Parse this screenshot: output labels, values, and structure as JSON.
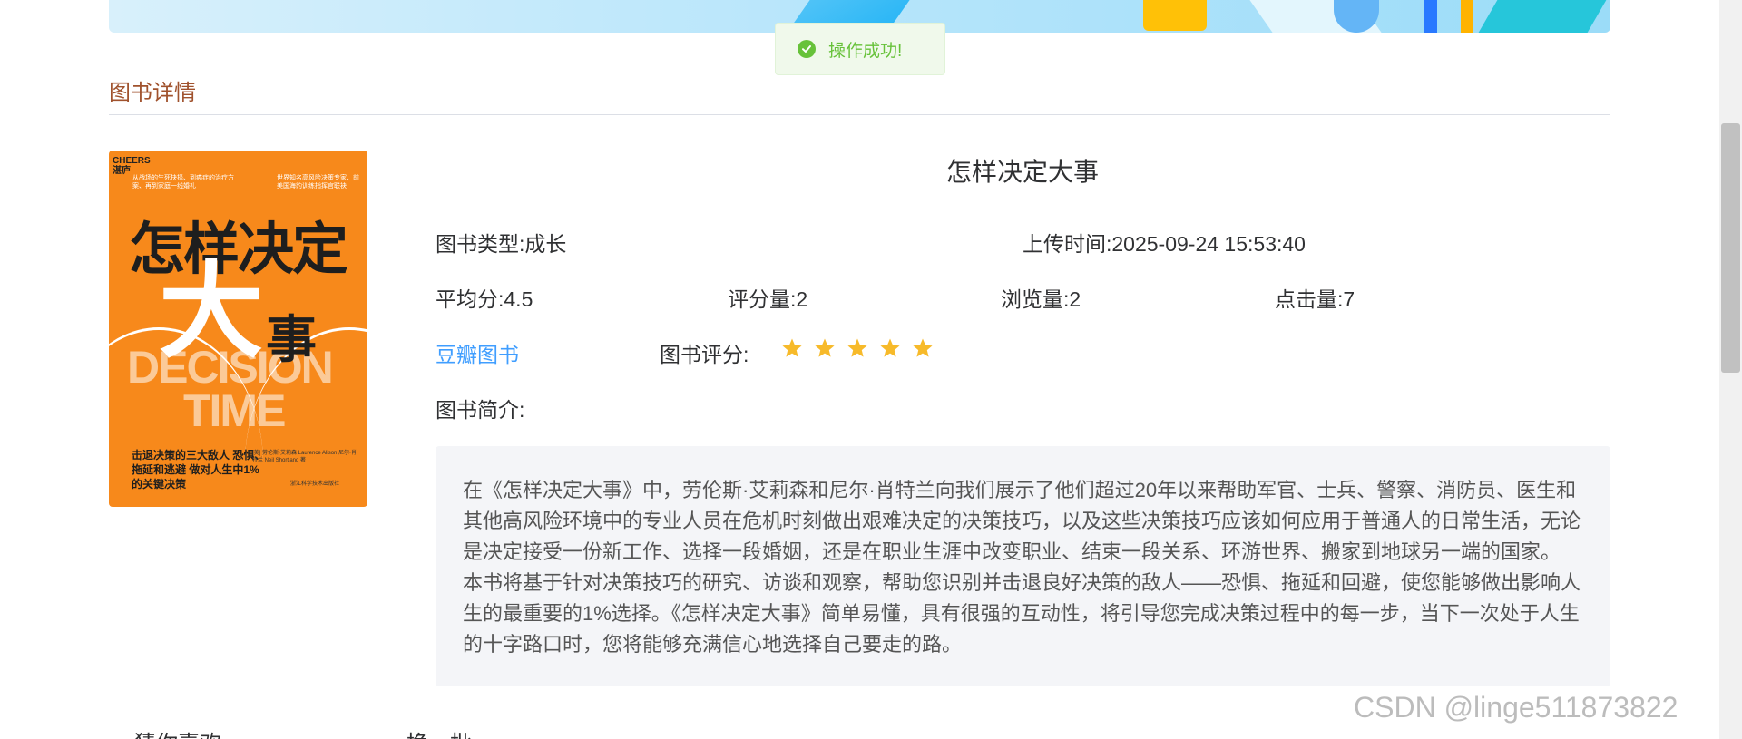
{
  "toast": {
    "text": "操作成功!",
    "icon": "check-circle-icon",
    "color": "#67c23a"
  },
  "section": {
    "title": "图书详情"
  },
  "cover": {
    "brand_line1": "CHEERS",
    "brand_line2": "湛庐",
    "tagline_left": "从战场的生死抉择、到癌症的治疗方案、再到家庭一线婚礼",
    "tagline_right": "世界知名高风险决策专家、前美国海豹训练指挥官联袂",
    "title_line1": "怎样决定",
    "title_big": "大",
    "title_small": "事",
    "english_line1": "DECISION",
    "english_line2": "TIME",
    "subtitle": "击退决策的三大敌人 恐惧、拖延和逃避 做对人生中1%的关键决策",
    "authors": "[美] 劳伦斯·艾莉森 Laurence Alison 尼尔·肖特兰 Neil Shortland 著",
    "publisher": "浙江科学技术出版社"
  },
  "book": {
    "title": "怎样决定大事",
    "type_label": "图书类型:",
    "type_value": "成长",
    "upload_label": "上传时间:",
    "upload_value": "2025-09-24 15:53:40",
    "avg_label": "平均分:",
    "avg_value": "4.5",
    "rating_count_label": "评分量:",
    "rating_count_value": "2",
    "view_label": "浏览量:",
    "view_value": "2",
    "click_label": "点击量:",
    "click_value": "7",
    "douban_link": "豆瓣图书",
    "rating_label": "图书评分:",
    "stars": 5,
    "star_color": "#f7ba2a",
    "intro_label": "图书简介:",
    "description": "在《怎样决定大事》中，劳伦斯·艾莉森和尼尔·肖特兰向我们展示了他们超过20年以来帮助军官、士兵、警察、消防员、医生和其他高风险环境中的专业人员在危机时刻做出艰难决定的决策技巧，以及这些决策技巧应该如何应用于普通人的日常生活，无论是决定接受一份新工作、选择一段婚姻，还是在职业生涯中改变职业、结束一段关系、环游世界、搬家到地球另一端的国家。 本书将基于针对决策技巧的研究、访谈和观察，帮助您识别并击退良好决策的敌人——恐惧、拖延和回避，使您能够做出影响人生的最重要的1%选择。《怎样决定大事》简单易懂，具有很强的互动性，将引导您完成决策过程中的每一步，当下一次处于人生的十字路口时，您将能够充满信心地选择自己要走的路。"
  },
  "bottom": {
    "left_text": "猜你喜欢:",
    "right_text": "换一批"
  },
  "watermark": "CSDN @linge511873822"
}
